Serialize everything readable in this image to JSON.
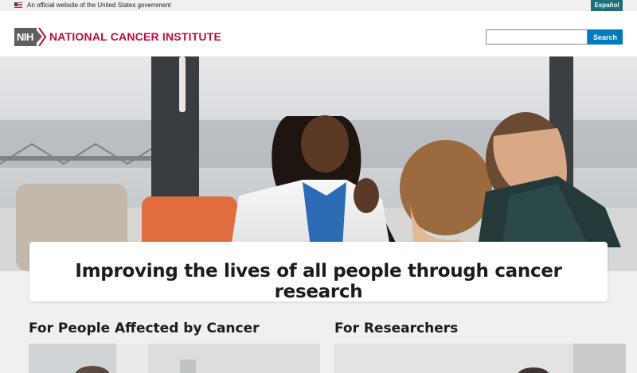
{
  "gov_banner": {
    "text": "An official website of the United States government",
    "flag_icon": "us-flag-icon",
    "espanol_label": "Español"
  },
  "header": {
    "logo_text": "NIH",
    "institute_name": "NATIONAL CANCER INSTITUTE",
    "search": {
      "placeholder": "",
      "value": "",
      "button_label": "Search"
    }
  },
  "hero": {
    "tagline": "Improving the lives of all people through cancer research"
  },
  "sections": [
    {
      "title": "For People Affected by Cancer"
    },
    {
      "title": "For Researchers"
    }
  ],
  "colors": {
    "brand_red": "#bb0e3d",
    "search_blue": "#007bbd",
    "espanol_teal": "#1b6f7a",
    "nih_gray": "#606060"
  }
}
